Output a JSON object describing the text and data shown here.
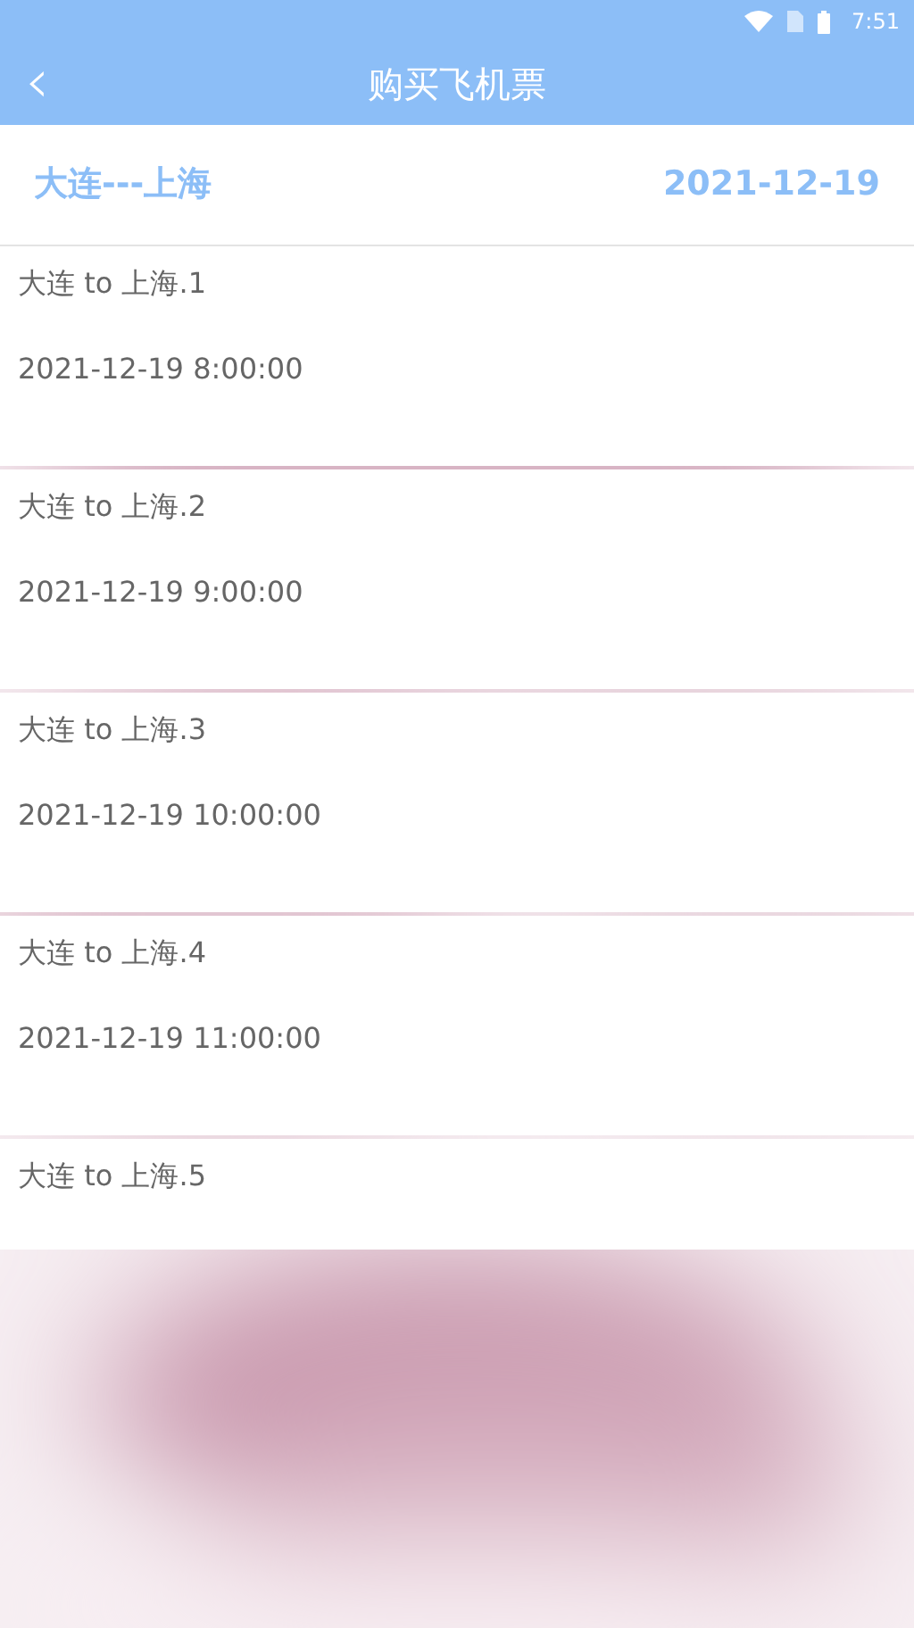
{
  "status_bar": {
    "time": "7:51"
  },
  "app_bar": {
    "back": "‹",
    "title": "购买飞机票"
  },
  "route_header": {
    "route": "大连---上海",
    "date": "2021-12-19"
  },
  "flights": [
    {
      "name": "大连 to 上海.1",
      "time": "2021-12-19 8:00:00"
    },
    {
      "name": "大连 to 上海.2",
      "time": "2021-12-19 9:00:00"
    },
    {
      "name": "大连 to 上海.3",
      "time": "2021-12-19 10:00:00"
    },
    {
      "name": "大连 to 上海.4",
      "time": "2021-12-19 11:00:00"
    },
    {
      "name": "大连 to 上海.5"
    }
  ]
}
